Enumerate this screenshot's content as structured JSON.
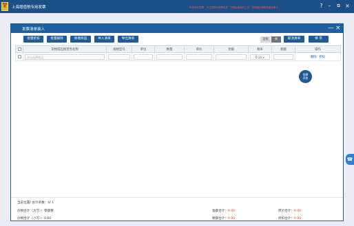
{
  "app": {
    "logo_text": "增值税",
    "title": "上海增值税专用发票",
    "warning": "剩余可开发票 · 请注意核对发票信息 · 开具后请及时上传 · 如有疑问请联系服务单位",
    "help_icon": "?",
    "minimize_icon": "–",
    "restore_icon": "⧉",
    "close_icon": "×"
  },
  "dialog": {
    "title": "发票清单录入",
    "minimize_icon": "—",
    "close_icon": "×"
  },
  "toolbar": {
    "buttons": [
      "批量折扣",
      "批量删除",
      "新增商品",
      "导入清单",
      "导出清单"
    ],
    "tax_included": "含税",
    "tax_excluded": "关",
    "cancel_label": "取消清单",
    "save_label": "保 存"
  },
  "table": {
    "headers": [
      "货物或应税劳务名称",
      "规格型号",
      "单位",
      "数量",
      "单价",
      "金额",
      "税率",
      "税额",
      "操作"
    ],
    "rows": [
      {
        "name_placeholder": "双击选择商品",
        "spec": "",
        "unit": "",
        "quantity": "",
        "price": "",
        "amount": "",
        "tax_rate": "0.13",
        "tax_amount": "",
        "ops": [
          "删除",
          "折扣"
        ]
      }
    ]
  },
  "quick_add": {
    "line1": "快捷",
    "line2": "添加"
  },
  "summary": {
    "position_label": "当前位置/ 总计条数：",
    "position_value": "0/ 1",
    "total_upper_label": "价税合计（大写）：",
    "total_upper_value": "零圆整",
    "total_lower_label": "价税合计（小写）：",
    "total_lower_value": "0.00",
    "amount_total_label": "金额合计：",
    "amount_total_value": "0.00",
    "tax_total_label": "税额合计：",
    "tax_total_value": "0.00",
    "quota_total_label": "原价合计：",
    "quota_total_value": "0.00",
    "discount_total_label": "折扣合计：",
    "discount_total_value": "0.00"
  },
  "side_tab_icon": "☎"
}
